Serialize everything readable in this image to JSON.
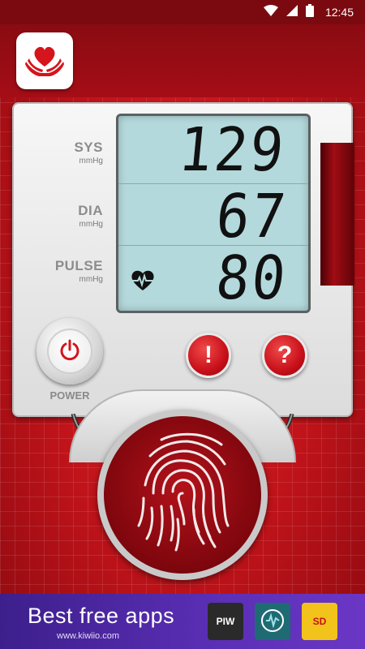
{
  "status_bar": {
    "time": "12:45",
    "icons": [
      "wifi-icon",
      "signal-icon",
      "battery-icon"
    ]
  },
  "app": {
    "logo_icon": "heart-hands-icon",
    "accent_color": "#c8101a"
  },
  "readings": {
    "sys": {
      "label": "SYS",
      "unit": "mmHg",
      "value": "129"
    },
    "dia": {
      "label": "DIA",
      "unit": "mmHg",
      "value": "67"
    },
    "pulse": {
      "label": "PULSE",
      "unit": "mmHg",
      "value": "80",
      "icon": "heart-pulse-icon"
    }
  },
  "controls": {
    "power_label": "POWER",
    "power_icon": "power-icon",
    "alert_label": "!",
    "help_label": "?"
  },
  "scanner": {
    "icon": "fingerprint-icon"
  },
  "ad": {
    "title": "Best free apps",
    "url": "www.kiwiio.com",
    "tiles": [
      {
        "label": "PIW",
        "color": "#2a2a2a"
      },
      {
        "label": "",
        "color": "#1f6b73"
      },
      {
        "label": "SD",
        "color": "#f1c31b"
      }
    ]
  }
}
